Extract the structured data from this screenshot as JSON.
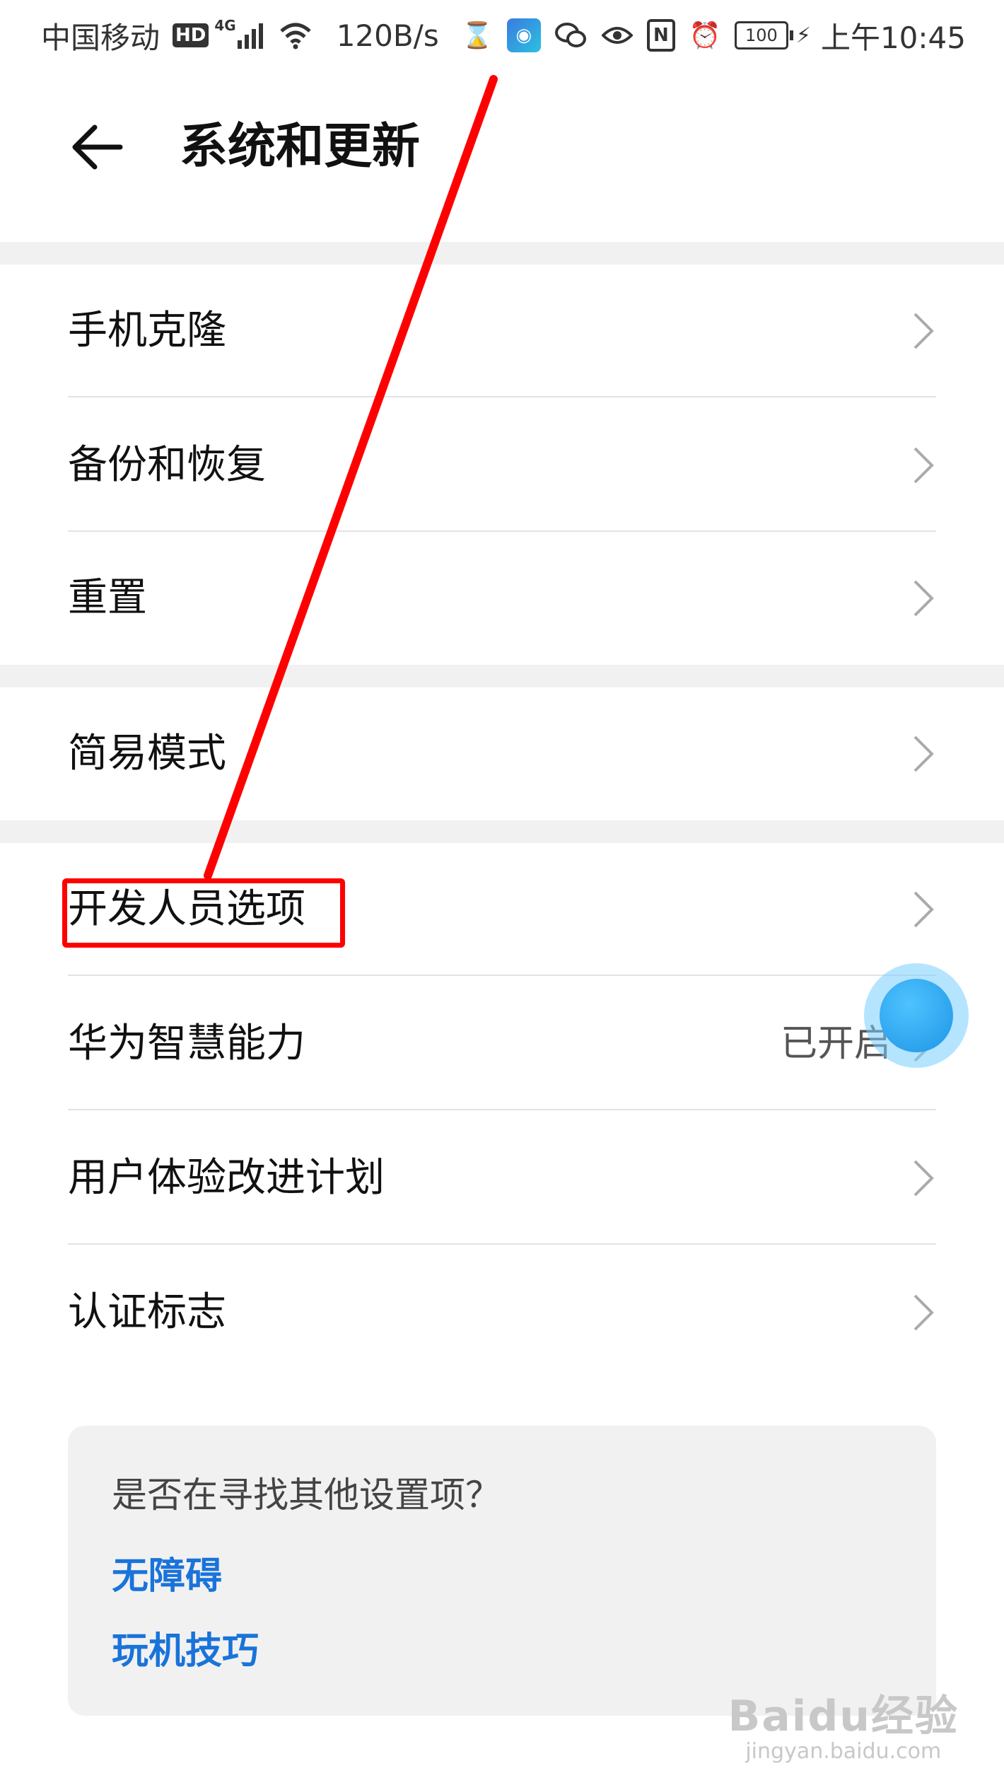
{
  "status_bar": {
    "carrier": "中国移动",
    "hd": "HD",
    "network": "4G",
    "speed": "120B/s",
    "battery": "100",
    "time": "上午10:45",
    "icons": [
      "hourglass-icon",
      "app-notification-icon",
      "wechat-icon",
      "eye-icon",
      "nfc-icon",
      "alarm-icon",
      "battery-icon",
      "charging-icon"
    ]
  },
  "header": {
    "title": "系统和更新",
    "back_icon": "arrow-left-icon"
  },
  "groups": [
    {
      "items": [
        {
          "label": "手机克隆"
        },
        {
          "label": "备份和恢复"
        },
        {
          "label": "重置"
        }
      ]
    },
    {
      "items": [
        {
          "label": "简易模式"
        }
      ]
    },
    {
      "items": [
        {
          "label": "开发人员选项",
          "highlighted": true
        },
        {
          "label": "华为智慧能力",
          "value": "已开启"
        },
        {
          "label": "用户体验改进计划"
        },
        {
          "label": "认证标志"
        }
      ]
    }
  ],
  "suggestion_card": {
    "question": "是否在寻找其他设置项？",
    "links": [
      "无障碍",
      "玩机技巧"
    ]
  },
  "watermark": {
    "logo": "Baidu经验",
    "url": "jingyan.baidu.com"
  },
  "colors": {
    "link": "#1a73d9",
    "annotation": "#ff0000",
    "background_band": "#f1f1f1",
    "touch_indicator": "#1e95e6"
  }
}
